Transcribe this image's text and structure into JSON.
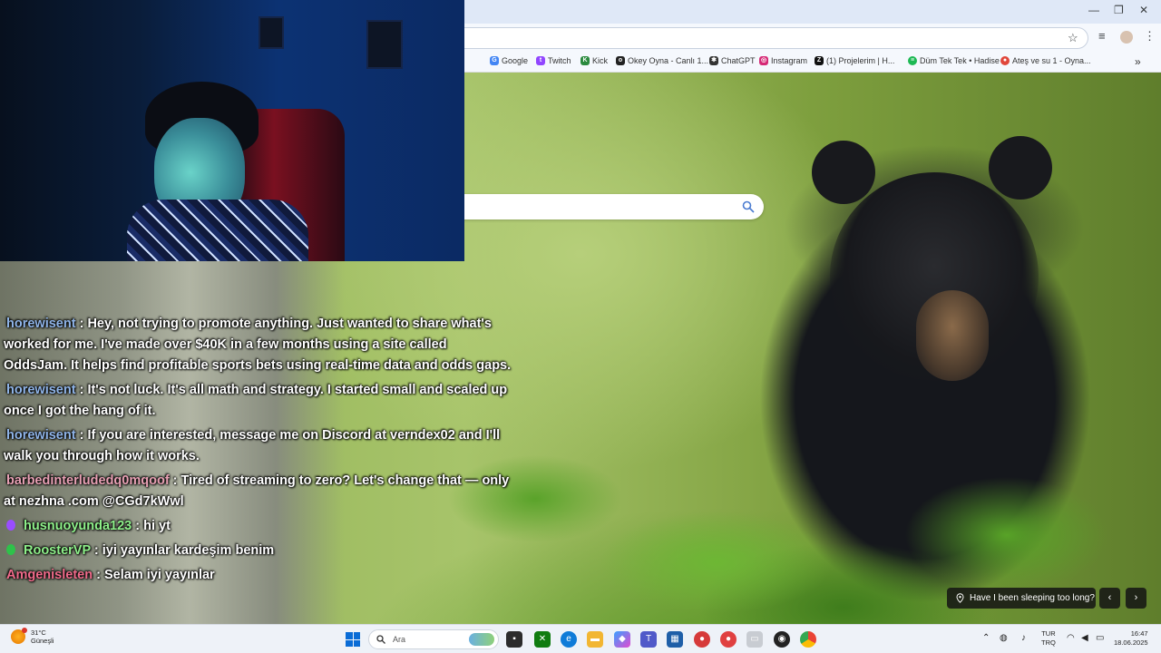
{
  "browser": {
    "window_controls": {
      "minimize": "—",
      "restore": "❐",
      "close": "✕"
    },
    "bookmarks": [
      {
        "label": "Google",
        "icon": "google-icon",
        "color": "#4285f4"
      },
      {
        "label": "Twitch",
        "icon": "twitch-icon",
        "color": "#9146ff"
      },
      {
        "label": "Kick",
        "icon": "kick-icon",
        "color": "#2b8a3e"
      },
      {
        "label": "Okey Oyna - Canlı 1...",
        "icon": "okey-icon",
        "color": "#222222"
      },
      {
        "label": "ChatGPT",
        "icon": "chatgpt-icon",
        "color": "#333333"
      },
      {
        "label": "Instagram",
        "icon": "instagram-icon",
        "color": "#d62976"
      },
      {
        "label": "(1) Projelerim | H...",
        "icon": "project-icon",
        "color": "#111111"
      },
      {
        "label": "Düm Tek Tek • Hadise",
        "icon": "spotify-icon",
        "color": "#1db954"
      },
      {
        "label": "Ateş ve su 1 - Oyna...",
        "icon": "game-icon",
        "color": "#e0463b"
      }
    ],
    "bookmarks_overflow": "»"
  },
  "chat": {
    "messages": [
      {
        "user": "horewisent",
        "user_color": "#8fb4e8",
        "badge": null,
        "text": "Hey, not trying to promote anything. Just wanted to share what's worked for me. I've made over $40K in a few months using a site called OddsJam. It helps find profitable sports bets using real-time data and odds gaps."
      },
      {
        "user": "horewisent",
        "user_color": "#8fb4e8",
        "badge": null,
        "text": "It's not luck. It's all math and strategy. I started small and scaled up once I got the hang of it."
      },
      {
        "user": "horewisent",
        "user_color": "#8fb4e8",
        "badge": null,
        "text": "If you are interested, message me on Discord at verndex02 and I'll walk you through how it works."
      },
      {
        "user": "barbedinterludedq0mqoof",
        "user_color": "#e8a0b4",
        "badge": null,
        "text": "Tired of streaming to zero? Let's change that — only at nezhna .com @CGd7kWwl"
      },
      {
        "user": "husnuoyunda123",
        "user_color": "#8ef08a",
        "badge": "#9a4dff",
        "text": "hi yt"
      },
      {
        "user": "RoosterVP",
        "user_color": "#8ef08a",
        "badge": "#2ec24a",
        "text": "iyi yayınlar kardeşim benim"
      },
      {
        "user": "Amgenisleten",
        "user_color": "#f06a8a",
        "badge": null,
        "text": "Selam iyi yayınlar"
      }
    ]
  },
  "spotlight": {
    "text": "Have I been sleeping too long?",
    "prev": "‹",
    "next": "›"
  },
  "taskbar": {
    "weather_temp": "31°C",
    "weather_desc": "Güneşli",
    "search_placeholder": "Ara",
    "language": [
      "TUR",
      "TRQ"
    ],
    "time": "16:47",
    "date": "18.06.2025"
  }
}
